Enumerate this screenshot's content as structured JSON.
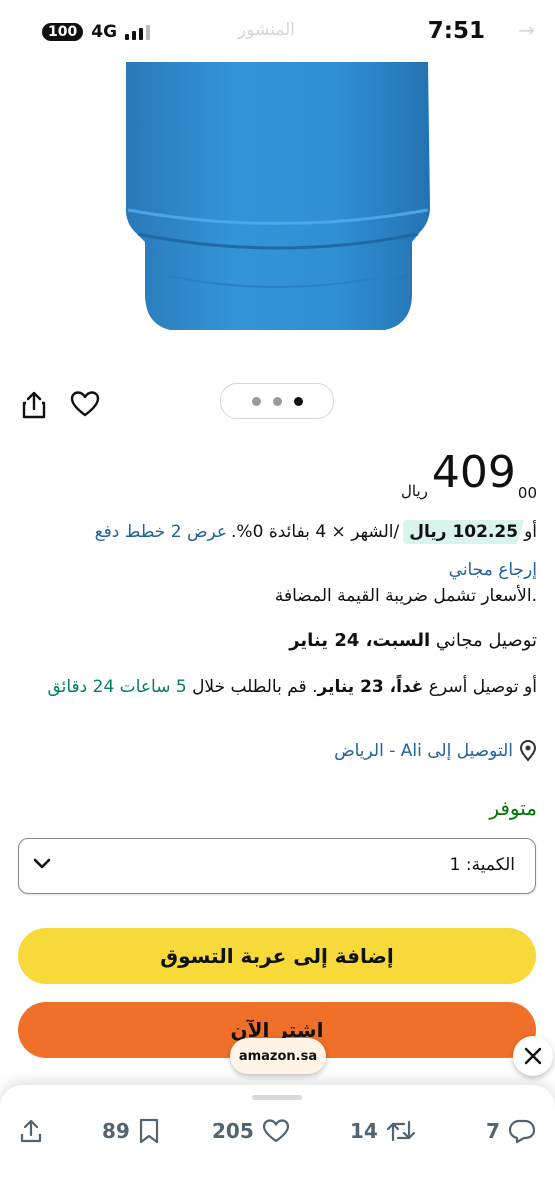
{
  "status_bar": {
    "time": "7:51",
    "battery": "100",
    "network": "4G",
    "faded_title": "المنشور"
  },
  "carousel": {
    "count": 3,
    "active": 2
  },
  "price": {
    "currency": "ريال",
    "whole": "409",
    "fraction": "00"
  },
  "installment": {
    "prefix": "أو",
    "amount": "102.25 ريال",
    "terms": "/الشهر × 4 بفائدة 0%.",
    "link": "عرض 2 خطط دفع"
  },
  "returns": {
    "label": "إرجاع مجاني"
  },
  "vat_note": ".الأسعار تشمل ضريبة القيمة المضافة",
  "delivery": {
    "prefix": "توصيل مجاني ",
    "date": "السبت، 24 يناير"
  },
  "fast_delivery": {
    "prefix": "أو توصيل أسرع ",
    "date": "غداً، 23 يناير",
    "middle": ". قم بالطلب خلال ",
    "countdown": "5 ساعات 24 دقائق"
  },
  "location": {
    "label": "التوصيل إلى Ali - الرياض"
  },
  "availability": "متوفر",
  "quantity": {
    "label": "الكمية:",
    "value": "1"
  },
  "buttons": {
    "add_to_cart": "إضافة إلى عربة التسوق",
    "buy_now": "اشتر الآن"
  },
  "overlay": {
    "source": "amazon.sa"
  },
  "tweet_actions": {
    "replies": "7",
    "retweets": "14",
    "likes": "205",
    "bookmarks": "89"
  },
  "colors": {
    "link": "#2162a1",
    "deal_green": "#067d62",
    "in_stock": "#007600",
    "cart_yellow": "#f8d93a",
    "buy_orange": "#f0702a",
    "product_blue": "#2f8fd2"
  },
  "icons": [
    "share-icon",
    "heart-icon",
    "location-pin-icon",
    "chevron-down-icon",
    "close-icon",
    "reply-icon",
    "retweet-icon",
    "like-icon",
    "bookmark-icon",
    "upload-icon"
  ]
}
